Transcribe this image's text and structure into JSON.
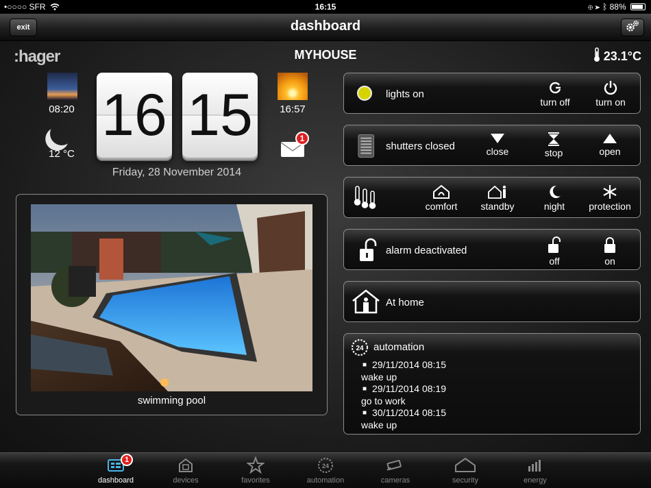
{
  "status_bar": {
    "carrier": "•○○○○ SFR",
    "time": "16:15",
    "battery": "88%",
    "icons": [
      "wifi-icon",
      "lock-rotation-icon",
      "location-icon",
      "bluetooth-icon",
      "battery-icon"
    ]
  },
  "title_bar": {
    "exit_label": "exit",
    "title": "dashboard",
    "settings_icon": "gear-icon"
  },
  "header": {
    "logo": ":hager",
    "house_name": "MYHOUSE",
    "outside_temperature": "23.1°C"
  },
  "weather": {
    "sunrise_time": "08:20",
    "sunset_time": "16:57",
    "night_temperature": "12 °C"
  },
  "clock": {
    "hours": "16",
    "minutes": "15",
    "date": "Friday, 28 November 2014"
  },
  "messages": {
    "unread": "1"
  },
  "camera": {
    "label": "swimming pool"
  },
  "controls": {
    "lights": {
      "status": "lights on",
      "action_off": "turn off",
      "action_on": "turn on",
      "indicator_color": "#d6d400"
    },
    "shutters": {
      "status": "shutters closed",
      "close": "close",
      "stop": "stop",
      "open": "open"
    },
    "heating": {
      "comfort": "comfort",
      "standby": "standby",
      "night": "night",
      "protection": "protection"
    },
    "alarm": {
      "status": "alarm deactivated",
      "off": "off",
      "on": "on"
    },
    "presence": {
      "status": "At home"
    }
  },
  "automation": {
    "title": "automation",
    "entries": [
      {
        "datetime": "29/11/2014 08:15",
        "name": "wake up"
      },
      {
        "datetime": "29/11/2014 08:19",
        "name": "go to work"
      },
      {
        "datetime": "30/11/2014 08:15",
        "name": "wake up"
      }
    ]
  },
  "tab_bar": {
    "tabs": [
      {
        "label": "dashboard",
        "icon": "dashboard-icon",
        "active": true,
        "badge": "1"
      },
      {
        "label": "devices",
        "icon": "devices-icon"
      },
      {
        "label": "favorites",
        "icon": "star-icon"
      },
      {
        "label": "automation",
        "icon": "automation-icon"
      },
      {
        "label": "cameras",
        "icon": "camera-icon"
      },
      {
        "label": "security",
        "icon": "house-icon"
      },
      {
        "label": "energy",
        "icon": "energy-bars-icon"
      }
    ]
  }
}
